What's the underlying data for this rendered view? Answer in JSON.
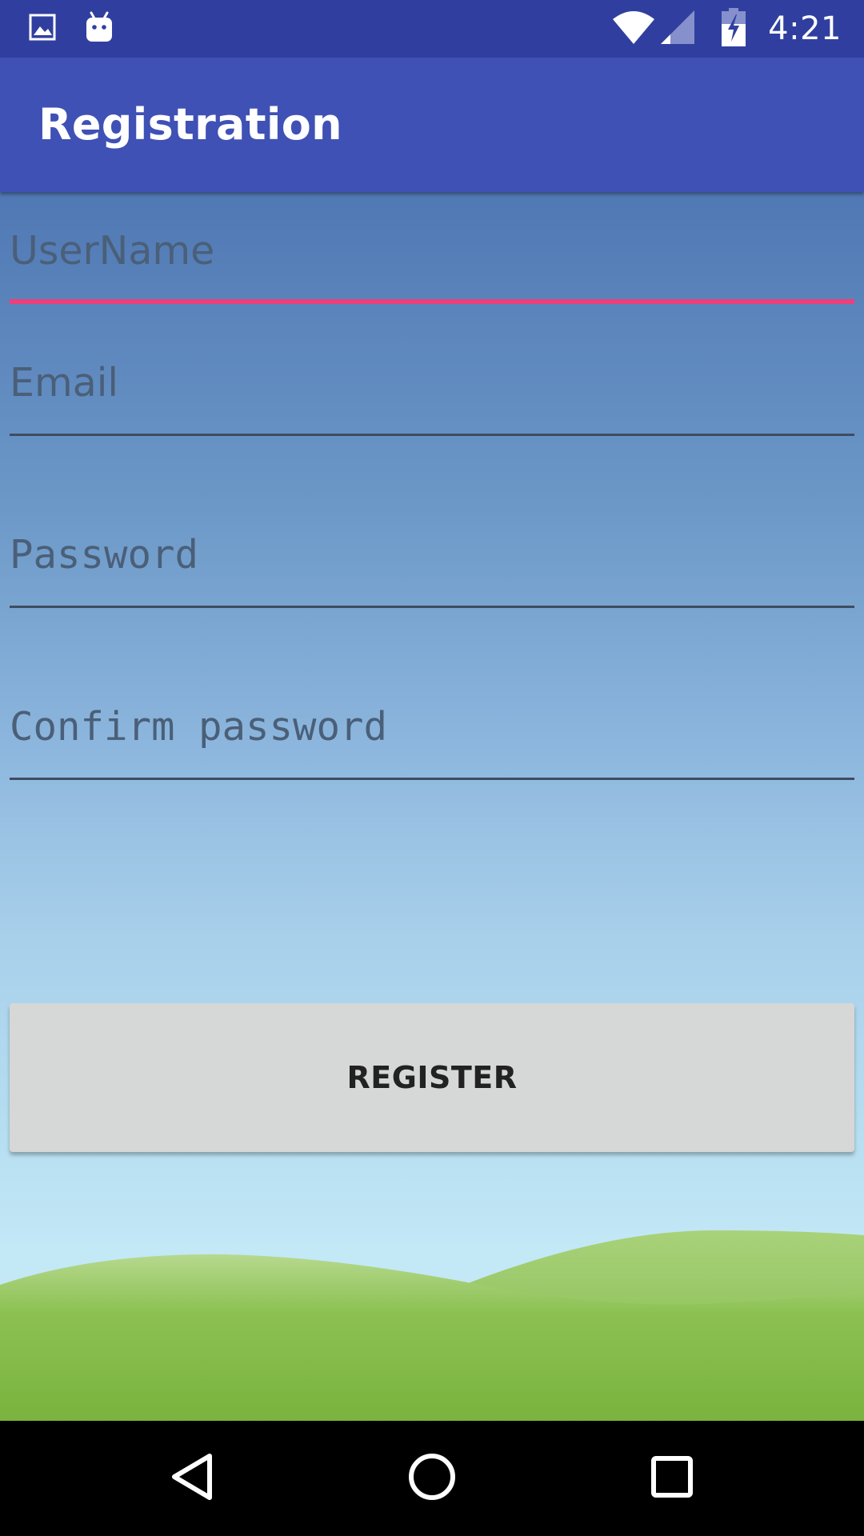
{
  "status_bar": {
    "time": "4:21",
    "icons": [
      "image-icon",
      "android-icon",
      "wifi-icon",
      "cell-signal-icon",
      "battery-charging-icon"
    ]
  },
  "app_bar": {
    "title": "Registration"
  },
  "form": {
    "username": {
      "placeholder": "UserName",
      "value": ""
    },
    "email": {
      "placeholder": "Email",
      "value": ""
    },
    "password": {
      "placeholder": "Password",
      "value": ""
    },
    "confirm_password": {
      "placeholder": "Confirm password",
      "value": ""
    },
    "register_label": "REGISTER"
  },
  "colors": {
    "status_bar": "#303f9f",
    "app_bar": "#3f51b5",
    "focus_accent": "#ec407a",
    "button_bg": "#d6d7d7"
  },
  "nav_bar": {
    "buttons": [
      "back-icon",
      "home-icon",
      "recents-icon"
    ]
  }
}
